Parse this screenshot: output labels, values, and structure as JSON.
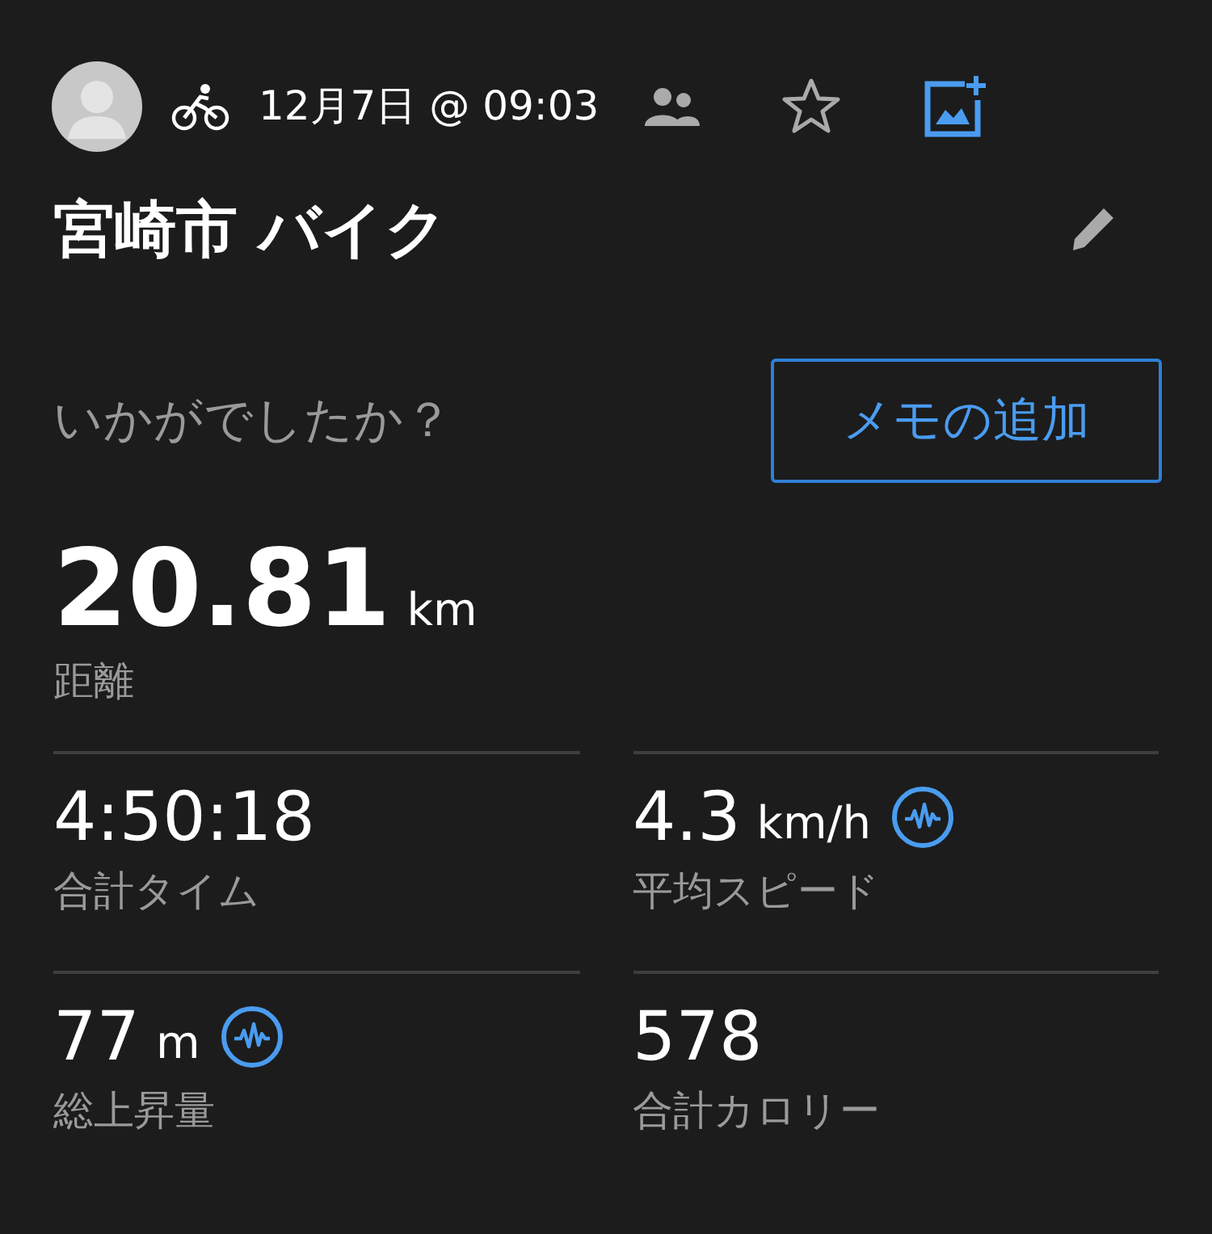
{
  "header": {
    "date": "12月7日 @ 09:03"
  },
  "title": "宮崎市 バイク",
  "prompt": "いかがでしたか？",
  "note_button": "メモの追加",
  "primary": {
    "value": "20.81",
    "unit": "km",
    "label": "距離"
  },
  "stats": [
    {
      "value": "4:50:18",
      "label": "合計タイム",
      "wave_icon": false
    },
    {
      "value": "4.3",
      "unit": "km/h",
      "label": "平均スピード",
      "wave_icon": true
    },
    {
      "value": "77",
      "unit": "m",
      "label": "総上昇量",
      "wave_icon": true
    },
    {
      "value": "578",
      "label": "合計カロリー",
      "wave_icon": false
    }
  ]
}
